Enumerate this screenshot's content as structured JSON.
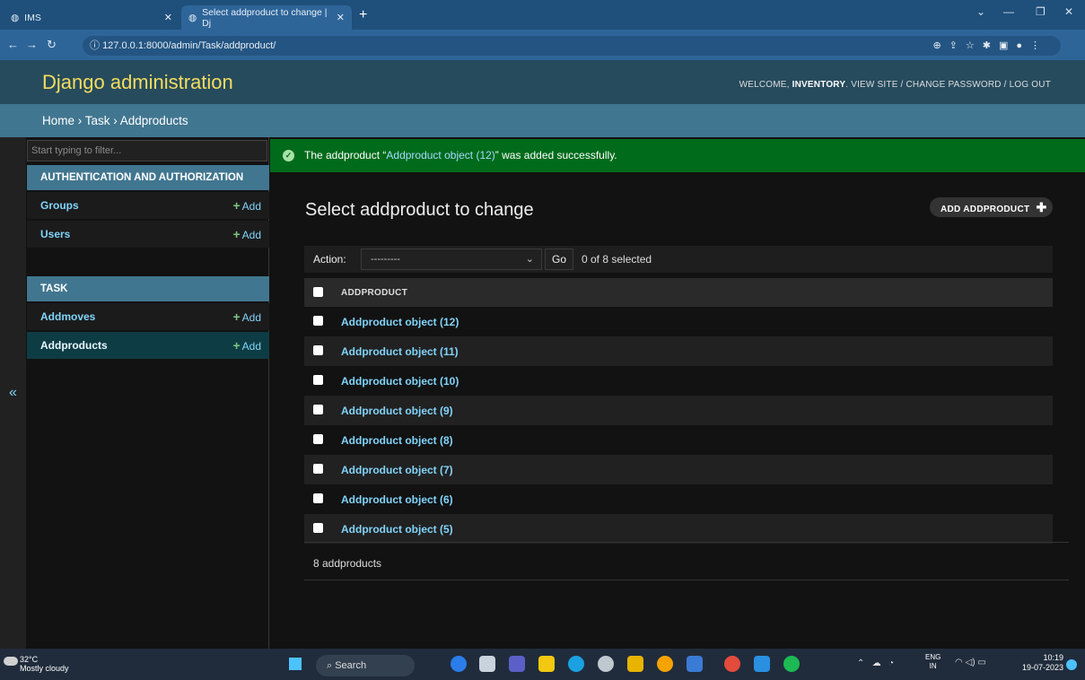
{
  "browser": {
    "tabs": [
      {
        "label": "IMS"
      },
      {
        "label": "Select addproduct to change | Dj"
      }
    ],
    "new_tab": "+",
    "url": "127.0.0.1:8000/admin/Task/addproduct/"
  },
  "header": {
    "brand": "Django administration",
    "welcome": "WELCOME,",
    "user": "INVENTORY",
    "links": "VIEW SITE / CHANGE PASSWORD / LOG OUT"
  },
  "breadcrumbs": "Home › Task › Addproducts",
  "sidebar": {
    "filter_placeholder": "Start typing to filter...",
    "toggle": "«",
    "modules": [
      {
        "caption": "AUTHENTICATION AND AUTHORIZATION",
        "items": [
          {
            "label": "Groups",
            "add": "Add"
          },
          {
            "label": "Users",
            "add": "Add"
          }
        ]
      },
      {
        "caption": "TASK",
        "items": [
          {
            "label": "Addmoves",
            "add": "Add"
          },
          {
            "label": "Addproducts",
            "add": "Add"
          }
        ]
      }
    ]
  },
  "message": {
    "prefix": "The addproduct “",
    "link": "Addproduct object (12)",
    "suffix": "” was added successfully."
  },
  "main": {
    "title": "Select addproduct to change",
    "add_button": "ADD ADDPRODUCT",
    "action_label": "Action:",
    "action_value": "---------",
    "go": "Go",
    "selected": "0 of 8 selected",
    "column": "ADDPRODUCT",
    "rows": [
      "Addproduct object (12)",
      "Addproduct object (11)",
      "Addproduct object (10)",
      "Addproduct object (9)",
      "Addproduct object (8)",
      "Addproduct object (7)",
      "Addproduct object (6)",
      "Addproduct object (5)"
    ],
    "paginator": "8 addproducts"
  },
  "taskbar": {
    "temp": "32°C",
    "weather": "Mostly cloudy",
    "search": "Search",
    "lang1": "ENG",
    "lang2": "IN",
    "time": "10:19",
    "date": "19-07-2023"
  },
  "colors": {
    "header": "#264b5d",
    "brand": "#f5dd5d",
    "breadcrumbs": "#417690",
    "success": "#006b1b",
    "link": "#81d4fa"
  }
}
